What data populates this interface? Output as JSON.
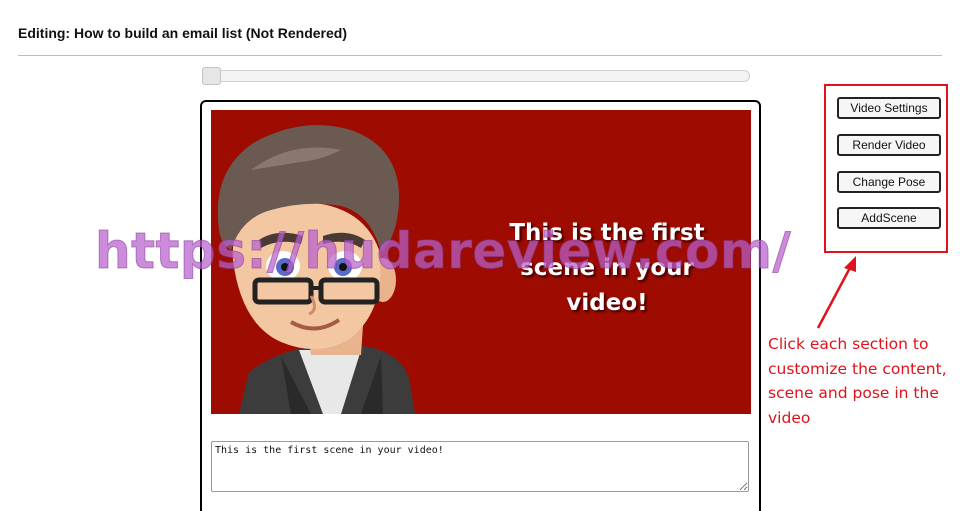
{
  "page": {
    "title": "Editing: How to build an email list (Not Rendered)"
  },
  "timeline": {
    "position": 0
  },
  "scene": {
    "preview_text": "This is the first scene in your video!",
    "background_color": "#9e0b00",
    "textarea_value": "This is the first scene in your video!"
  },
  "actions": {
    "video_settings": "Video Settings",
    "render_video": "Render Video",
    "change_pose": "Change Pose",
    "add_scene": "AddScene",
    "highlight_color": "#e0121b"
  },
  "annotation": {
    "text": "Click each section to customize the content, scene and pose in the video"
  },
  "watermark": {
    "text": "https://hudareview.com/"
  }
}
